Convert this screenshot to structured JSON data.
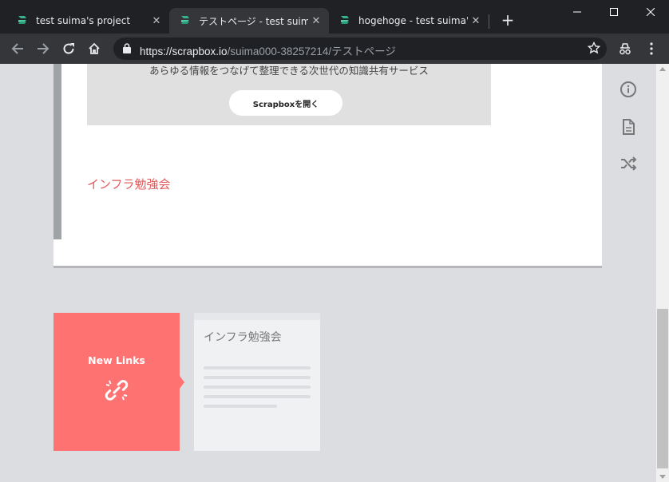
{
  "browser": {
    "tabs": [
      {
        "title": "test suima's project",
        "active": false
      },
      {
        "title": "テストページ - test suima's p",
        "active": true
      },
      {
        "title": "hogehoge - test suima's p",
        "active": false
      }
    ],
    "tab_close_glyph": "✕",
    "new_tab_glyph": "+",
    "url": {
      "scheme_host": "https://scrapbox.io",
      "path": "/suima000-38257214/テストページ"
    }
  },
  "page": {
    "embed_text": "あらゆる情報をつなげて整理できる次世代の知識共有サービス",
    "embed_button": "Scrapboxを開く",
    "link_text": "インフラ勉強会"
  },
  "related": {
    "new_links_label": "New Links",
    "card_title": "インフラ勉強会"
  },
  "colors": {
    "accent_link": "#e05a5a",
    "new_links_bg": "#ff7272",
    "scrapbox_green": "#37b38b"
  }
}
